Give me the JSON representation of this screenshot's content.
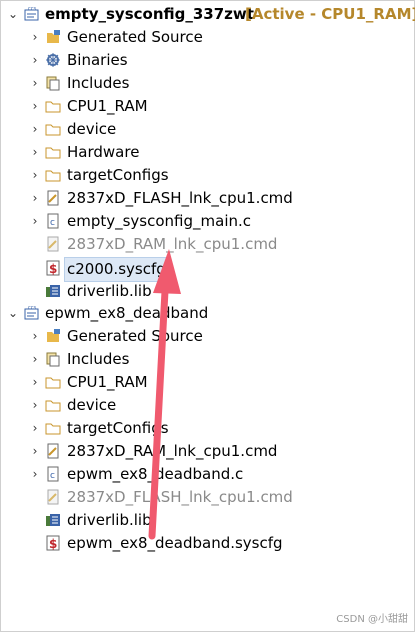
{
  "projects": [
    {
      "name": "empty_sysconfig_337zwt",
      "status": "[Active - CPU1_RAM]",
      "children": [
        {
          "label": "Generated Source",
          "icon": "generated-source-icon"
        },
        {
          "label": "Binaries",
          "icon": "binaries-icon"
        },
        {
          "label": "Includes",
          "icon": "includes-icon"
        },
        {
          "label": "CPU1_RAM",
          "icon": "folder-icon"
        },
        {
          "label": "device",
          "icon": "folder-icon"
        },
        {
          "label": "Hardware",
          "icon": "folder-icon"
        },
        {
          "label": "targetConfigs",
          "icon": "folder-icon"
        },
        {
          "label": "2837xD_FLASH_lnk_cpu1.cmd",
          "icon": "cmd-file-icon"
        },
        {
          "label": "empty_sysconfig_main.c",
          "icon": "c-file-icon"
        },
        {
          "label": "2837xD_RAM_lnk_cpu1.cmd",
          "icon": "cmd-file-excluded-icon"
        },
        {
          "label": "c2000.syscfg",
          "icon": "syscfg-file-icon"
        },
        {
          "label": "driverlib.lib",
          "icon": "library-icon"
        }
      ]
    },
    {
      "name": "epwm_ex8_deadband",
      "status": "",
      "children": [
        {
          "label": "Generated Source",
          "icon": "generated-source-icon"
        },
        {
          "label": "Includes",
          "icon": "includes-icon"
        },
        {
          "label": "CPU1_RAM",
          "icon": "folder-icon"
        },
        {
          "label": "device",
          "icon": "folder-icon"
        },
        {
          "label": "targetConfigs",
          "icon": "folder-icon"
        },
        {
          "label": "2837xD_RAM_lnk_cpu1.cmd",
          "icon": "cmd-file-icon"
        },
        {
          "label": "epwm_ex8_deadband.c",
          "icon": "c-file-icon"
        },
        {
          "label": "2837xD_FLASH_lnk_cpu1.cmd",
          "icon": "cmd-file-excluded-icon"
        },
        {
          "label": "driverlib.lib",
          "icon": "library-icon"
        },
        {
          "label": "epwm_ex8_deadband.syscfg",
          "icon": "syscfg-file-icon"
        }
      ]
    }
  ],
  "footer": "CSDN @小甜甜",
  "colors": {
    "active_status": "#b5872b",
    "excluded_text": "#8a8a8a",
    "selection": "#dde8f6",
    "arrow": "#f05a6e",
    "folder": "#e8b84a"
  }
}
